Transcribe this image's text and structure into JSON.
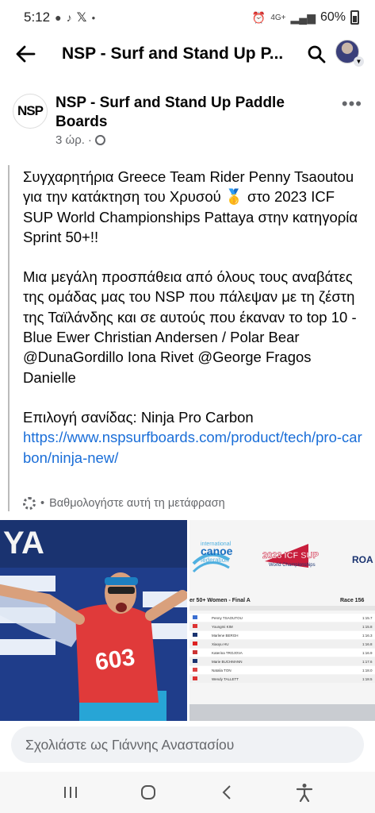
{
  "status_bar": {
    "time": "5:12",
    "network": "4G+",
    "battery": "60%"
  },
  "header": {
    "title": "NSP - Surf and Stand Up P..."
  },
  "post": {
    "page_avatar_text": "NSP",
    "page_name": "NSP - Surf and Stand Up Paddle Boards",
    "time_ago": "3 ώρ.",
    "separator": "·",
    "paragraph1": "Συγχαρητήρια Greece Team Rider Penny Tsaoutou για την κατάκτηση του Χρυσού 🥇 στο 2023 ICF SUP World Championships Pattaya στην κατηγορία Sprint 50+!!",
    "paragraph2": "Μια μεγάλη προσπάθεια από όλους τους αναβάτες της ομάδας μας του NSP που πάλεψαν με τη ζέστη της Ταϊλάνδης και σε αυτούς που έκαναν το top 10 - Blue Ewer Christian Andersen / Polar Bear @DunaGordillo Iona Rivet @George Fragos Danielle",
    "board_line": "Επιλογή σανίδας: Ninja Pro Carbon",
    "link": "https://www.nspsurfboards.com/product/tech/pro-carbon/ninja-new/",
    "rate_translation": "Βαθμολογήστε αυτή τη μετάφραση",
    "rate_separator": "•"
  },
  "photo_right": {
    "federation_text": "international canoe federation",
    "event_logo_text": "2023 ICF SUP",
    "event_logo_sub": "World Championships",
    "results_heading": "er 50+ Women - Final A",
    "race_label": "Race 156",
    "results": [
      {
        "name": "Penny TSAOUTOU",
        "time": "1:15.7"
      },
      {
        "name": "Youngmi KIM",
        "time": "1:15.8"
      },
      {
        "name": "Marlene BERGH",
        "time": "1:16.3"
      },
      {
        "name": "Xiaoyu HU",
        "time": "1:16.8"
      },
      {
        "name": "Katerina TROJOVA",
        "time": "1:16.9"
      },
      {
        "name": "Marie BUCHMANN",
        "time": "1:17.6"
      },
      {
        "name": "Natalia TON",
        "time": "1:18.0"
      },
      {
        "name": "Wendy TALLETT",
        "time": "1:18.5"
      }
    ]
  },
  "comment": {
    "placeholder": "Σχολιάστε ως Γιάννης Αναστασίου"
  },
  "colors": {
    "link": "#1a6ed8",
    "meta": "#65676b",
    "comment_bg": "#f0f2f5"
  },
  "icons": [
    "back-arrow-icon",
    "search-icon",
    "more-icon",
    "globe-icon",
    "gear-icon",
    "recents-icon",
    "home-icon",
    "back-icon",
    "accessibility-icon"
  ]
}
